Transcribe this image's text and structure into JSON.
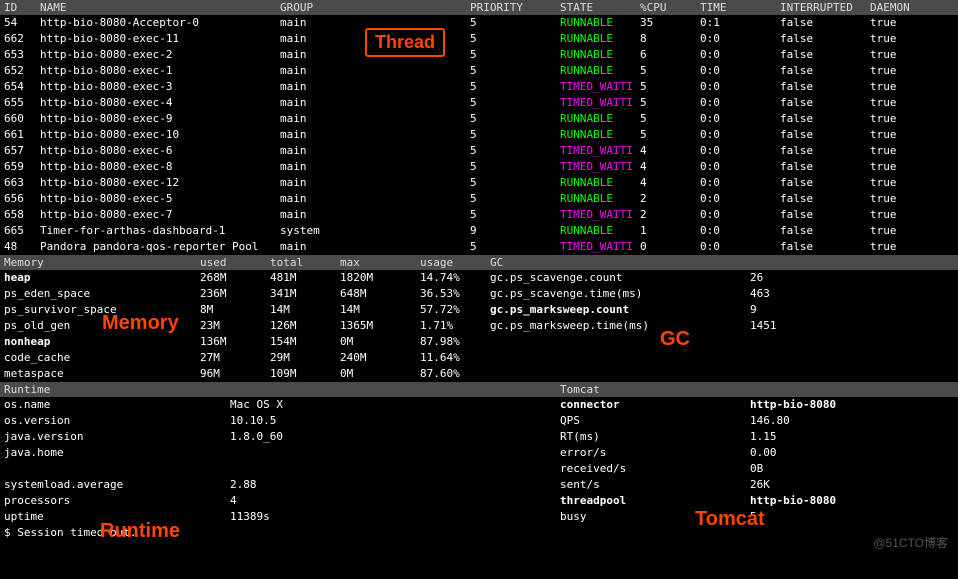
{
  "thread_header": {
    "id": "ID",
    "name": "NAME",
    "group": "GROUP",
    "priority": "PRIORITY",
    "state": "STATE",
    "cpu": "%CPU",
    "time": "TIME",
    "interrupted": "INTERRUPTED",
    "daemon": "DAEMON"
  },
  "threads": [
    {
      "id": "54",
      "name": "http-bio-8080-Acceptor-0",
      "group": "main",
      "priority": "5",
      "state": "RUNNABLE",
      "state_class": "green",
      "cpu": "35",
      "time": "0:1",
      "interrupted": "false",
      "daemon": "true"
    },
    {
      "id": "662",
      "name": "http-bio-8080-exec-11",
      "group": "main",
      "priority": "5",
      "state": "RUNNABLE",
      "state_class": "green",
      "cpu": "8",
      "time": "0:0",
      "interrupted": "false",
      "daemon": "true"
    },
    {
      "id": "653",
      "name": "http-bio-8080-exec-2",
      "group": "main",
      "priority": "5",
      "state": "RUNNABLE",
      "state_class": "green",
      "cpu": "6",
      "time": "0:0",
      "interrupted": "false",
      "daemon": "true"
    },
    {
      "id": "652",
      "name": "http-bio-8080-exec-1",
      "group": "main",
      "priority": "5",
      "state": "RUNNABLE",
      "state_class": "green",
      "cpu": "5",
      "time": "0:0",
      "interrupted": "false",
      "daemon": "true"
    },
    {
      "id": "654",
      "name": "http-bio-8080-exec-3",
      "group": "main",
      "priority": "5",
      "state": "TIMED_WAITI",
      "state_class": "magenta",
      "cpu": "5",
      "time": "0:0",
      "interrupted": "false",
      "daemon": "true"
    },
    {
      "id": "655",
      "name": "http-bio-8080-exec-4",
      "group": "main",
      "priority": "5",
      "state": "TIMED_WAITI",
      "state_class": "magenta",
      "cpu": "5",
      "time": "0:0",
      "interrupted": "false",
      "daemon": "true"
    },
    {
      "id": "660",
      "name": "http-bio-8080-exec-9",
      "group": "main",
      "priority": "5",
      "state": "RUNNABLE",
      "state_class": "green",
      "cpu": "5",
      "time": "0:0",
      "interrupted": "false",
      "daemon": "true"
    },
    {
      "id": "661",
      "name": "http-bio-8080-exec-10",
      "group": "main",
      "priority": "5",
      "state": "RUNNABLE",
      "state_class": "green",
      "cpu": "5",
      "time": "0:0",
      "interrupted": "false",
      "daemon": "true"
    },
    {
      "id": "657",
      "name": "http-bio-8080-exec-6",
      "group": "main",
      "priority": "5",
      "state": "TIMED_WAITI",
      "state_class": "magenta",
      "cpu": "4",
      "time": "0:0",
      "interrupted": "false",
      "daemon": "true"
    },
    {
      "id": "659",
      "name": "http-bio-8080-exec-8",
      "group": "main",
      "priority": "5",
      "state": "TIMED_WAITI",
      "state_class": "magenta",
      "cpu": "4",
      "time": "0:0",
      "interrupted": "false",
      "daemon": "true"
    },
    {
      "id": "663",
      "name": "http-bio-8080-exec-12",
      "group": "main",
      "priority": "5",
      "state": "RUNNABLE",
      "state_class": "green",
      "cpu": "4",
      "time": "0:0",
      "interrupted": "false",
      "daemon": "true"
    },
    {
      "id": "656",
      "name": "http-bio-8080-exec-5",
      "group": "main",
      "priority": "5",
      "state": "RUNNABLE",
      "state_class": "green",
      "cpu": "2",
      "time": "0:0",
      "interrupted": "false",
      "daemon": "true"
    },
    {
      "id": "658",
      "name": "http-bio-8080-exec-7",
      "group": "main",
      "priority": "5",
      "state": "TIMED_WAITI",
      "state_class": "magenta",
      "cpu": "2",
      "time": "0:0",
      "interrupted": "false",
      "daemon": "true"
    },
    {
      "id": "665",
      "name": "Timer-for-arthas-dashboard-1",
      "group": "system",
      "priority": "9",
      "state": "RUNNABLE",
      "state_class": "green",
      "cpu": "1",
      "time": "0:0",
      "interrupted": "false",
      "daemon": "true"
    },
    {
      "id": "48",
      "name": "Pandora pandora-qos-reporter Pool",
      "group": "main",
      "priority": "5",
      "state": "TIMED_WAITI",
      "state_class": "magenta",
      "cpu": "0",
      "time": "0:0",
      "interrupted": "false",
      "daemon": "true"
    }
  ],
  "mem_header": {
    "label": "Memory",
    "used": "used",
    "total": "total",
    "max": "max",
    "usage": "usage",
    "gc": "GC"
  },
  "memory": [
    {
      "label": "heap",
      "bold": true,
      "used": "268M",
      "total": "481M",
      "max": "1820M",
      "usage": "14.74%"
    },
    {
      "label": "ps_eden_space",
      "bold": false,
      "used": "236M",
      "total": "341M",
      "max": "648M",
      "usage": "36.53%"
    },
    {
      "label": "ps_survivor_space",
      "bold": false,
      "used": "8M",
      "total": "14M",
      "max": "14M",
      "usage": "57.72%"
    },
    {
      "label": "ps_old_gen",
      "bold": false,
      "used": "23M",
      "total": "126M",
      "max": "1365M",
      "usage": "1.71%"
    },
    {
      "label": "nonheap",
      "bold": true,
      "used": "136M",
      "total": "154M",
      "max": "0M",
      "usage": "87.98%"
    },
    {
      "label": "code_cache",
      "bold": false,
      "used": "27M",
      "total": "29M",
      "max": "240M",
      "usage": "11.64%"
    },
    {
      "label": "metaspace",
      "bold": false,
      "used": "96M",
      "total": "109M",
      "max": "0M",
      "usage": "87.60%"
    }
  ],
  "gc": [
    {
      "label": "gc.ps_scavenge.count",
      "bold": false,
      "val": "26"
    },
    {
      "label": "gc.ps_scavenge.time(ms)",
      "bold": false,
      "val": "463"
    },
    {
      "label": "gc.ps_marksweep.count",
      "bold": true,
      "val": "9"
    },
    {
      "label": "gc.ps_marksweep.time(ms)",
      "bold": false,
      "val": "1451"
    }
  ],
  "rt_header": {
    "runtime": "Runtime",
    "tomcat": "Tomcat"
  },
  "runtime": [
    {
      "label": "os.name",
      "val": "Mac OS X"
    },
    {
      "label": "os.version",
      "val": "10.10.5"
    },
    {
      "label": "java.version",
      "val": "1.8.0_60"
    },
    {
      "label": "java.home",
      "val": ""
    },
    {
      "label": "",
      "val": ""
    },
    {
      "label": "systemload.average",
      "val": "2.88"
    },
    {
      "label": "processors",
      "val": "4"
    },
    {
      "label": "uptime",
      "val": "11389s"
    }
  ],
  "tomcat": [
    {
      "label": "connector",
      "bold": true,
      "val": "http-bio-8080"
    },
    {
      "label": "QPS",
      "bold": false,
      "val": "146.80"
    },
    {
      "label": "RT(ms)",
      "bold": false,
      "val": "1.15"
    },
    {
      "label": "error/s",
      "bold": false,
      "val": "0.00"
    },
    {
      "label": "received/s",
      "bold": false,
      "val": "0B"
    },
    {
      "label": "sent/s",
      "bold": false,
      "val": "26K"
    },
    {
      "label": "threadpool",
      "bold": true,
      "val": "http-bio-8080"
    },
    {
      "label": "busy",
      "bold": false,
      "val": "5"
    }
  ],
  "prompt": "$ Session timed out.",
  "watermark": "@51CTO博客",
  "tags": {
    "thread": "Thread",
    "memory": "Memory",
    "gc": "GC",
    "runtime": "Runtime",
    "tomcat": "Tomcat"
  }
}
